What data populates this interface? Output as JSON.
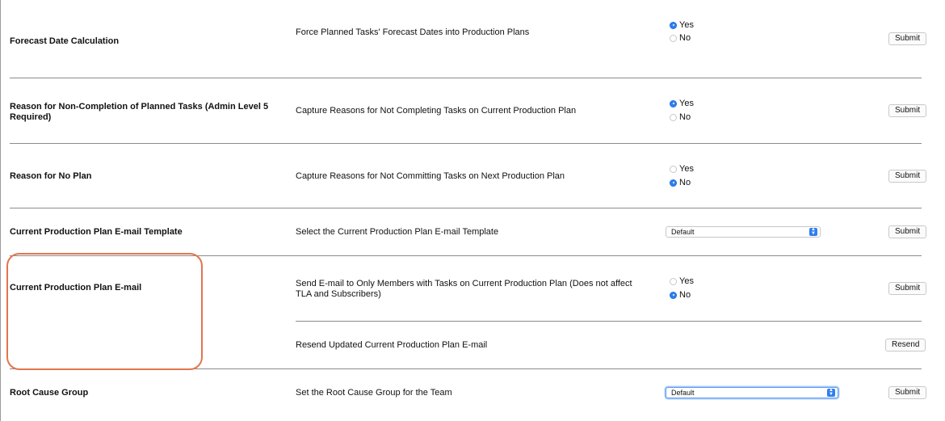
{
  "rows": {
    "forecast": {
      "label": "Forecast Date Calculation",
      "description": "Force Planned Tasks' Forecast Dates into Production Plans",
      "options": [
        "Yes",
        "No"
      ],
      "selected": "Yes",
      "button": "Submit"
    },
    "non_completion": {
      "label": "Reason for Non-Completion of Planned Tasks (Admin Level 5 Required)",
      "description": "Capture Reasons for Not Completing Tasks on Current Production Plan",
      "options": [
        "Yes",
        "No"
      ],
      "selected": "Yes",
      "button": "Submit"
    },
    "no_plan": {
      "label": "Reason for No Plan",
      "description": "Capture Reasons for Not Committing Tasks on Next Production Plan",
      "options": [
        "Yes",
        "No"
      ],
      "selected": "No",
      "button": "Submit"
    },
    "email_template": {
      "label": "Current Production Plan E-mail Template",
      "description": "Select the Current Production Plan E-mail Template",
      "select_value": "Default",
      "button": "Submit"
    },
    "plan_email": {
      "label": "Current Production Plan E-mail",
      "description": "Send E-mail to Only Members with Tasks on Current Production Plan (Does not affect TLA and Subscribers)",
      "options": [
        "Yes",
        "No"
      ],
      "selected": "No",
      "button": "Submit",
      "resend_description": "Resend Updated Current Production Plan E-mail",
      "resend_button": "Resend"
    },
    "root_cause": {
      "label": "Root Cause Group",
      "description": "Set the Root Cause Group for the Team",
      "select_value": "Default",
      "button": "Submit"
    }
  },
  "colors": {
    "accent": "#2f80ed",
    "highlight": "#e2754e",
    "divider": "#8c8c8c"
  }
}
